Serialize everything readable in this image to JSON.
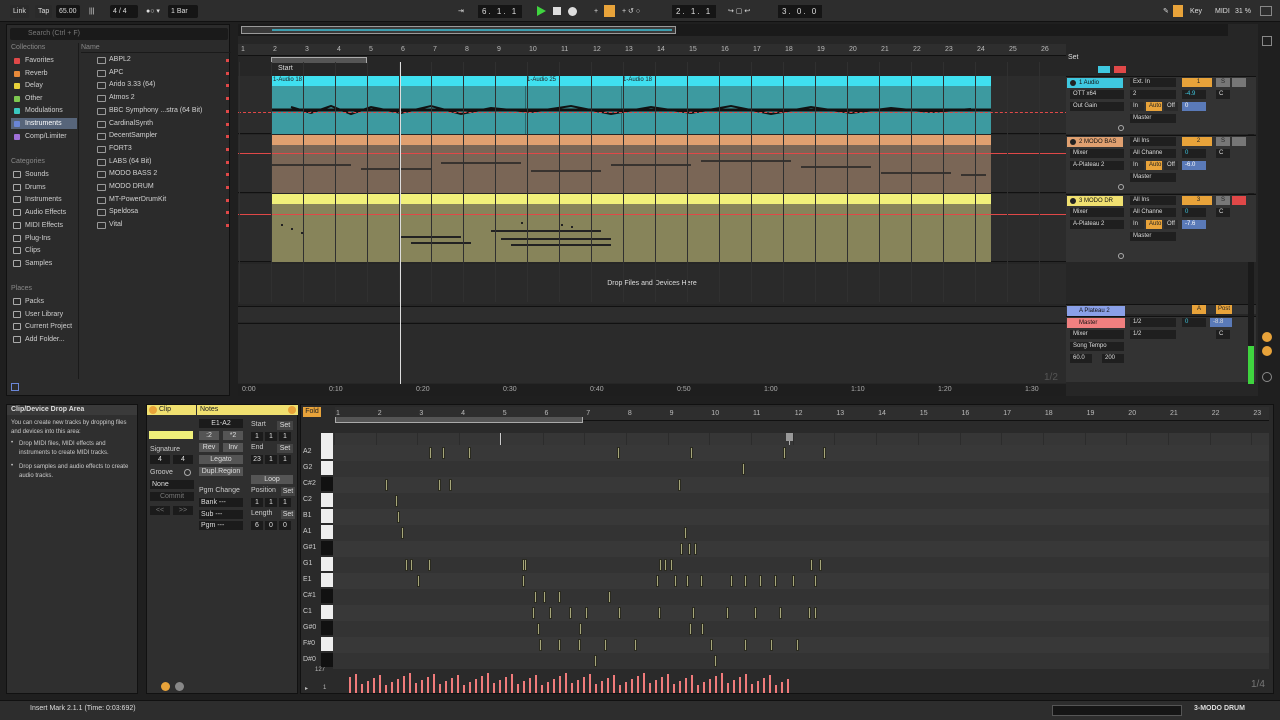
{
  "transport": {
    "link": "Link",
    "tap": "Tap",
    "tempo": "65.00",
    "sig_num": "4",
    "sig_den": "4",
    "quantize": "1 Bar",
    "arrangement_position": "6. 1. 1",
    "loop_start": "2. 1. 1",
    "loop_length": "3. 0. 0",
    "key": "Key",
    "midi": "MIDI",
    "cpu": "31 %"
  },
  "browser": {
    "search_placeholder": "Search (Ctrl + F)",
    "collections_title": "Collections",
    "collections": [
      {
        "label": "Favorites",
        "color": "#e04848"
      },
      {
        "label": "Reverb",
        "color": "#e88a3a"
      },
      {
        "label": "Delay",
        "color": "#e8d23a"
      },
      {
        "label": "Other",
        "color": "#7ec850"
      },
      {
        "label": "Modulations",
        "color": "#3ac8c0"
      },
      {
        "label": "Instruments",
        "color": "#6a86d8"
      },
      {
        "label": "Comp/Limiter",
        "color": "#a070d8"
      }
    ],
    "categories_title": "Categories",
    "categories": [
      "Sounds",
      "Drums",
      "Instruments",
      "Audio Effects",
      "MIDI Effects",
      "Plug-Ins",
      "Clips",
      "Samples"
    ],
    "places_title": "Places",
    "places": [
      "Packs",
      "User Library",
      "Current Project",
      "Add Folder..."
    ],
    "name_header": "Name",
    "plugins": [
      "ABPL2",
      "APC",
      "Arido 3.33 (64)",
      "Atmos 2",
      "BBC Symphony ...stra (64 Bit)",
      "CardinalSynth",
      "DecentSampler",
      "FORT3",
      "LABS (64 Bit)",
      "MODO BASS 2",
      "MODO DRUM",
      "MT-PowerDrumKit",
      "Speldosa",
      "Vital"
    ]
  },
  "arrangement": {
    "bar_numbers": [
      "1",
      "2",
      "3",
      "4",
      "5",
      "6",
      "7",
      "8",
      "9",
      "10",
      "11",
      "12",
      "13",
      "14",
      "15",
      "16",
      "17",
      "18",
      "19",
      "20",
      "21",
      "22",
      "23",
      "24",
      "25",
      "26"
    ],
    "start_marker": "Start",
    "audio_clips": [
      "1-Audio 18",
      "1-Audio 25",
      "1-Audio 18"
    ],
    "drop_text": "Drop Files and Devices Here",
    "time_labels": [
      "0:00",
      "0:10",
      "0:20",
      "0:30",
      "0:40",
      "0:50",
      "1:00",
      "1:10",
      "1:20",
      "1:30"
    ],
    "zoom_ratio": "1/2",
    "set_label": "Set"
  },
  "tracks": [
    {
      "name": "1 Audio",
      "color": "#3fc8e0",
      "input": "Ext. In",
      "input_ch": "2",
      "device": "OTT x64",
      "param": "Out Gain",
      "output": "Master",
      "num": "1",
      "vol": "-4.9",
      "send": "0",
      "pan": "C",
      "monitor_in": "In",
      "monitor_auto": "Auto",
      "monitor_off": "Off"
    },
    {
      "name": "2 MODO BAS",
      "color": "#e0a070",
      "input": "All Ins",
      "input_ch": "All Channe",
      "device": "Mixer",
      "param": "A-Plateau 2",
      "output": "Master",
      "num": "2",
      "vol": "0",
      "send": "-6.0",
      "pan": "C",
      "monitor_in": "In",
      "monitor_auto": "Auto",
      "monitor_off": "Off"
    },
    {
      "name": "3 MODO DR",
      "color": "#f0e070",
      "input": "All Ins",
      "input_ch": "All Channe",
      "device": "Mixer",
      "param": "A-Plateau 2",
      "output": "Master",
      "num": "3",
      "vol": "0",
      "send": "-7.6",
      "pan": "C",
      "monitor_in": "In",
      "monitor_auto": "Auto",
      "monitor_off": "Off"
    }
  ],
  "return_track": {
    "name": "A Plateau 2",
    "letter": "A",
    "post": "Post",
    "color": "#8aa0e8"
  },
  "master_track": {
    "name": "Master",
    "color": "#f08080",
    "device": "Mixer",
    "tempo_label": "Song Tempo",
    "tempo_min": "60.0",
    "tempo_max": "200",
    "out1": "1/2",
    "out2": "1/2",
    "vol": "0",
    "send": "-8.8",
    "pan": "C"
  },
  "drop_area": {
    "title": "Clip/Device Drop Area",
    "intro": "You can create new tracks by dropping files and devices into this area:",
    "bullet1": "Drop MIDI files, MIDI effects and instruments to create MIDI tracks.",
    "bullet2": "Drop samples and audio effects to create audio tracks."
  },
  "clip_view": {
    "clip_tab": "Clip",
    "notes_tab": "Notes",
    "signature_label": "Signature",
    "sig_num": "4",
    "sig_den": "4",
    "groove_label": "Groove",
    "groove_value": "None",
    "commit": "Commit",
    "range": "E1-A2",
    "div2": ":2",
    "mul2": "*2",
    "rev": "Rev",
    "inv": "Inv",
    "legato": "Legato",
    "dupl": "Dupl.Region",
    "start_label": "Start",
    "start_val": [
      "1",
      "1",
      "1"
    ],
    "end_label": "End",
    "end_val": [
      "23",
      "1",
      "1"
    ],
    "set": "Set",
    "loop": "Loop",
    "position_label": "Position",
    "position_val": [
      "1",
      "1",
      "1"
    ],
    "length_label": "Length",
    "length_val": [
      "6",
      "0",
      "0"
    ],
    "pgm_change": "Pgm Change",
    "bank": "Bank ---",
    "sub": "Sub ---",
    "pgm": "Pgm ---"
  },
  "piano_roll": {
    "fold": "Fold",
    "bar_numbers": [
      "1",
      "2",
      "3",
      "4",
      "5",
      "6",
      "7",
      "8",
      "9",
      "10",
      "11",
      "12",
      "13",
      "14",
      "15",
      "16",
      "17",
      "18",
      "19",
      "20",
      "21",
      "22",
      "23"
    ],
    "key_labels": [
      "A2",
      "G2",
      "C#2",
      "C2",
      "B1",
      "A1",
      "G#1",
      "G1",
      "E1",
      "C#1",
      "C1",
      "G#0",
      "F#0",
      "D#0"
    ],
    "vel_max": "127",
    "vel_min": "1",
    "zoom_ratio": "1/4"
  },
  "status": {
    "message": "Insert Mark 2.1.1 (Time: 0:03:692)",
    "track_name": "3-MODO DRUM"
  }
}
